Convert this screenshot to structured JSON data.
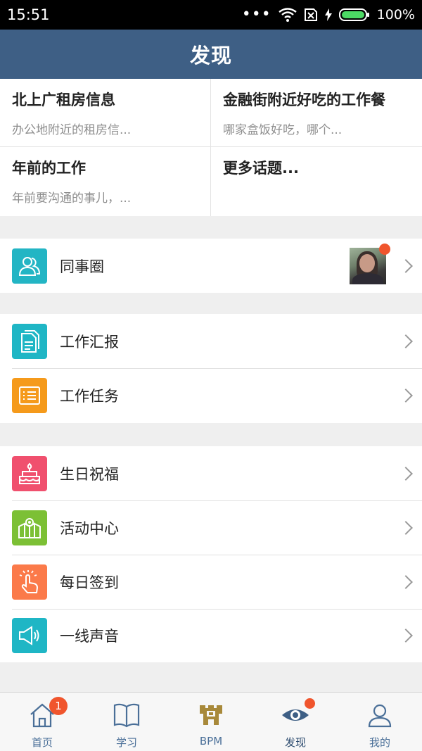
{
  "status_bar": {
    "time": "15:51",
    "battery": "100%"
  },
  "header": {
    "title": "发现"
  },
  "topics": [
    {
      "title": "北上广租房信息",
      "subtitle": "办公地附近的租房信..."
    },
    {
      "title": "金融街附近好吃的工作餐",
      "subtitle": "哪家盒饭好吃，哪个..."
    },
    {
      "title": "年前的工作",
      "subtitle": "年前要沟通的事儿，..."
    },
    {
      "title": "更多话题...",
      "subtitle": ""
    }
  ],
  "groups": [
    [
      {
        "label": "同事圈",
        "icon": "colleagues-icon",
        "color": "#23b5c4"
      }
    ],
    [
      {
        "label": "工作汇报",
        "icon": "report-icon",
        "color": "#1fb6c5"
      },
      {
        "label": "工作任务",
        "icon": "task-list-icon",
        "color": "#f59a1b"
      }
    ],
    [
      {
        "label": "生日祝福",
        "icon": "birthday-cake-icon",
        "color": "#f0506e"
      },
      {
        "label": "活动中心",
        "icon": "activity-icon",
        "color": "#7cc035"
      },
      {
        "label": "每日签到",
        "icon": "tap-hand-icon",
        "color": "#fb7a4a"
      },
      {
        "label": "一线声音",
        "icon": "megaphone-icon",
        "color": "#1fb6c5"
      }
    ]
  ],
  "tabs": [
    {
      "label": "首页",
      "icon": "home-icon",
      "badge": "1"
    },
    {
      "label": "学习",
      "icon": "book-icon"
    },
    {
      "label": "BPM",
      "icon": "bpm-logo-icon"
    },
    {
      "label": "发现",
      "icon": "eye-icon"
    },
    {
      "label": "我的",
      "icon": "profile-icon"
    }
  ],
  "colors": {
    "nav_bar": "#3e5f85",
    "badge": "#f0552d",
    "tab_label": "#4a6f98",
    "bpm_gold": "#a8893a"
  }
}
